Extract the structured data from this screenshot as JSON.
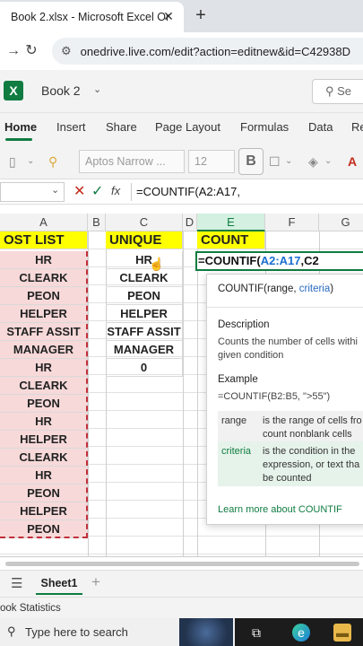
{
  "browser": {
    "tab_title": "Book 2.xlsx - Microsoft Excel Or",
    "close_glyph": "✕",
    "new_tab_glyph": "+",
    "url": "onedrive.live.com/edit?action=editnew&id=C42938D"
  },
  "app": {
    "title": "Book 2",
    "search_label": "Se"
  },
  "ribbon": {
    "tabs": [
      "Home",
      "Insert",
      "Share",
      "Page Layout",
      "Formulas",
      "Data",
      "Re"
    ]
  },
  "toolbar": {
    "font_name": "Aptos Narrow ...",
    "font_size": "12",
    "bold_label": "B"
  },
  "formula_bar": {
    "fx_label": "fx",
    "content": "=COUNTIF(A2:A17,"
  },
  "grid": {
    "columns": [
      "A",
      "B",
      "C",
      "D",
      "E",
      "F",
      "G"
    ],
    "a_header": "OST LIST",
    "c_header": "UNIQUE",
    "e_header": "COUNT",
    "a_values": [
      "HR",
      "CLEARK",
      "PEON",
      "HELPER",
      "STAFF ASSIT",
      "MANAGER",
      "HR",
      "CLEARK",
      "PEON",
      "HR",
      "HELPER",
      "CLEARK",
      "HR",
      "PEON",
      "HELPER",
      "PEON"
    ],
    "c_values": [
      "HR",
      "CLEARK",
      "PEON",
      "HELPER",
      "STAFF ASSIT",
      "MANAGER",
      "0"
    ],
    "e2_prefix": "=COUNTIF(",
    "e2_ref": "A2:A17",
    "e2_suffix": ",C2"
  },
  "tooltip": {
    "func": "COUNTIF(",
    "arg1": "range, ",
    "arg2": "criteria",
    "close": ")",
    "description_heading": "Description",
    "description_line1": "Counts the number of cells withi",
    "description_line2": "given condition",
    "example_heading": "Example",
    "example_text": "=COUNTIF(B2:B5, \">55\")",
    "params": [
      {
        "name": "range",
        "line1": "is the range of cells fro",
        "line2": "count nonblank cells",
        "line3": ""
      },
      {
        "name": "criteria",
        "line1": "is the condition in the",
        "line2": "expression, or text tha",
        "line3": "be counted"
      }
    ],
    "learn_more": "Learn more about COUNTIF"
  },
  "sheets": {
    "active": "Sheet1",
    "status": "ook Statistics"
  },
  "taskbar": {
    "search_text": "Type here to search"
  }
}
